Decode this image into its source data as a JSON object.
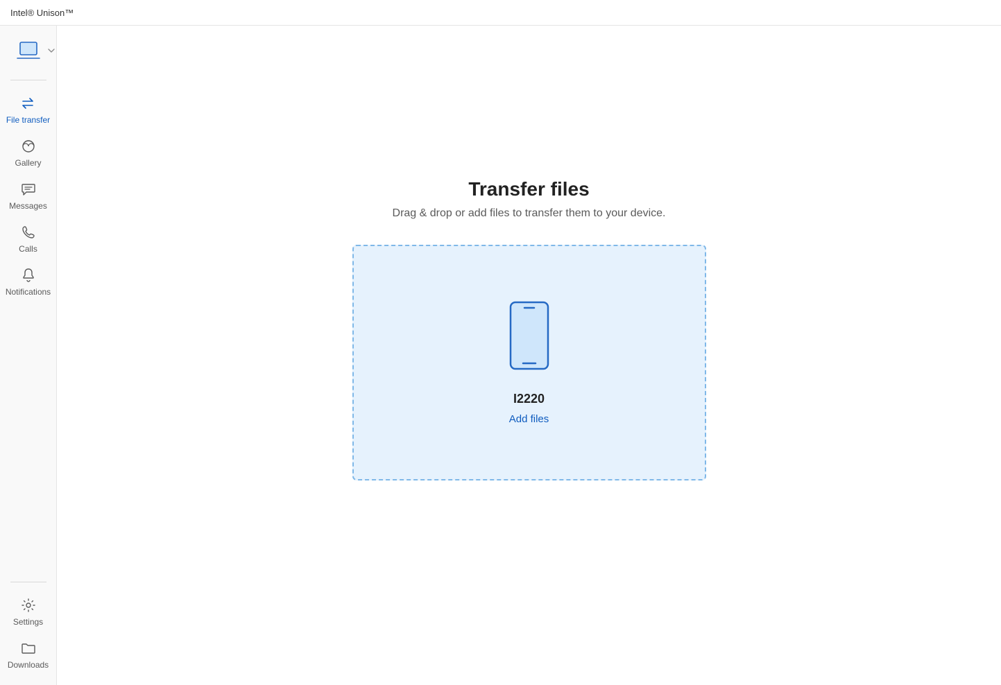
{
  "app": {
    "title": "Intel® Unison™"
  },
  "sidebar": {
    "items": [
      {
        "label": "File transfer"
      },
      {
        "label": "Gallery"
      },
      {
        "label": "Messages"
      },
      {
        "label": "Calls"
      },
      {
        "label": "Notifications"
      }
    ],
    "bottom": [
      {
        "label": "Settings"
      },
      {
        "label": "Downloads"
      }
    ]
  },
  "main": {
    "title": "Transfer files",
    "subtitle": "Drag & drop or add files to transfer them to your device.",
    "device_name": "I2220",
    "add_files": "Add files"
  }
}
